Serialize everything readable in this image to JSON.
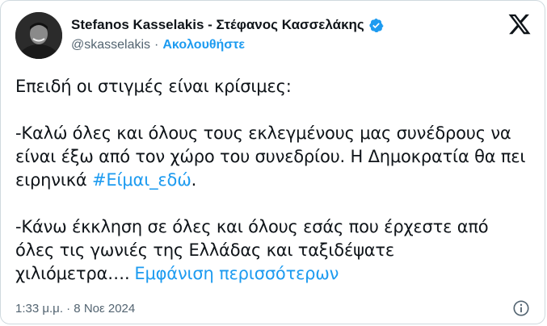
{
  "author": {
    "display_name": "Stefanos Kasselakis - Στέφανος Κασσελάκης",
    "handle": "@skasselakis",
    "separator": "·",
    "follow_label": "Ακολουθήστε"
  },
  "tweet": {
    "line1": "Επειδή οι στιγμές είναι κρίσιμες:",
    "para2_text": "-Καλώ όλες και όλους τους εκλεγμένους μας συνέδρους να είναι έξω από τον χώρο του συνεδρίου. Η Δημοκρατία θα πει ειρηνικά ",
    "hashtag": "#Είμαι_εδώ",
    "para2_end": ".",
    "para3_text": "-Κάνω έκκληση σε όλες και όλους εσάς που έρχεστε από όλες τις γωνιές της Ελλάδας και ταξιδέψατε χιλιόμετρα….",
    "show_more": "Εμφάνιση περισσότερων"
  },
  "footer": {
    "timestamp": "1:33 μ.μ. · 8 Νοε 2024"
  },
  "icons": {
    "verified": "verified-badge-icon",
    "x_logo": "x-logo-icon",
    "info": "info-icon"
  },
  "colors": {
    "accent": "#1d9bf0",
    "secondary_text": "#536471",
    "text": "#0f1419",
    "border": "#cfd9de"
  }
}
